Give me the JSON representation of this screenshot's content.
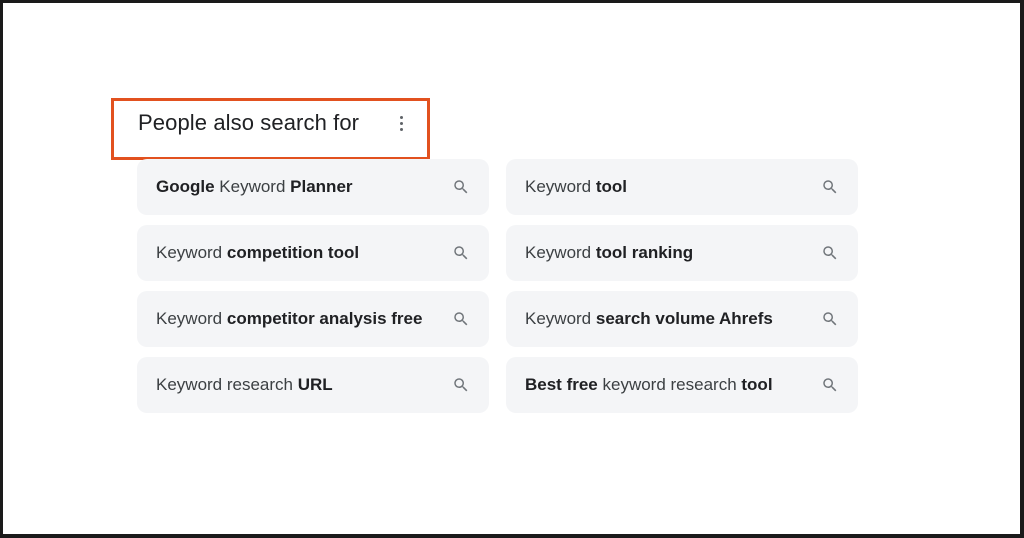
{
  "section": {
    "title": "People also search for",
    "more_icon": "more-vert-icon",
    "highlight_color": "#e2511f"
  },
  "suggestions": [
    {
      "parts": [
        {
          "text": "Google",
          "bold": true
        },
        {
          "text": " Keyword ",
          "bold": false
        },
        {
          "text": "Planner",
          "bold": true
        }
      ],
      "icon": "search-icon"
    },
    {
      "parts": [
        {
          "text": "Keyword ",
          "bold": false
        },
        {
          "text": "tool",
          "bold": true
        }
      ],
      "icon": "search-icon"
    },
    {
      "parts": [
        {
          "text": "Keyword ",
          "bold": false
        },
        {
          "text": "competition tool",
          "bold": true
        }
      ],
      "icon": "search-icon"
    },
    {
      "parts": [
        {
          "text": "Keyword ",
          "bold": false
        },
        {
          "text": "tool ranking",
          "bold": true
        }
      ],
      "icon": "search-icon"
    },
    {
      "parts": [
        {
          "text": "Keyword ",
          "bold": false
        },
        {
          "text": "competitor analysis free",
          "bold": true
        }
      ],
      "icon": "search-icon"
    },
    {
      "parts": [
        {
          "text": "Keyword ",
          "bold": false
        },
        {
          "text": "search volume Ahrefs",
          "bold": true
        }
      ],
      "icon": "search-icon"
    },
    {
      "parts": [
        {
          "text": "Keyword research ",
          "bold": false
        },
        {
          "text": "URL",
          "bold": true
        }
      ],
      "icon": "search-icon"
    },
    {
      "parts": [
        {
          "text": "Best free",
          "bold": true
        },
        {
          "text": " keyword research ",
          "bold": false
        },
        {
          "text": "tool",
          "bold": true
        }
      ],
      "icon": "search-icon"
    }
  ]
}
